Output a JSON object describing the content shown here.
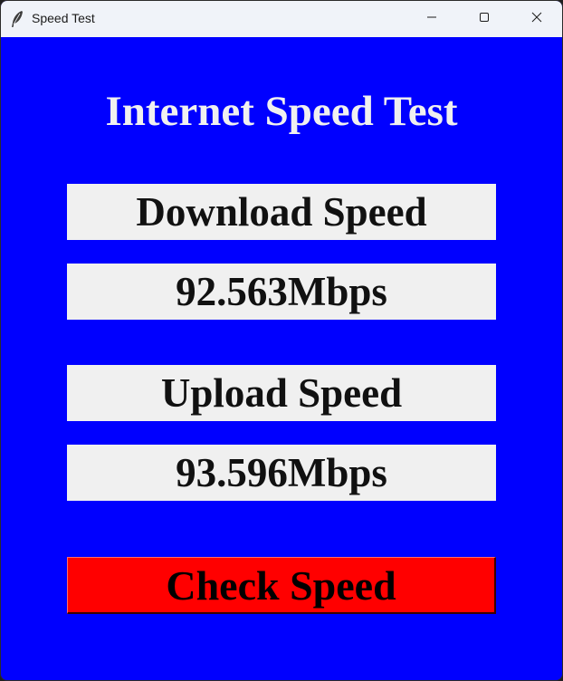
{
  "window": {
    "title": "Speed Test",
    "app_icon": "feather-icon",
    "controls": [
      "minimize-icon",
      "maximize-icon",
      "close-icon"
    ]
  },
  "main": {
    "heading": "Internet Speed Test",
    "download": {
      "label": "Download Speed",
      "value": "92.563Mbps"
    },
    "upload": {
      "label": "Upload Speed",
      "value": "93.596Mbps"
    },
    "check_button_label": "Check Speed"
  },
  "colors": {
    "background": "#0000ff",
    "label_background": "#f0f0f0",
    "button_background": "#ff0000",
    "heading_text": "#f0f0f0"
  }
}
